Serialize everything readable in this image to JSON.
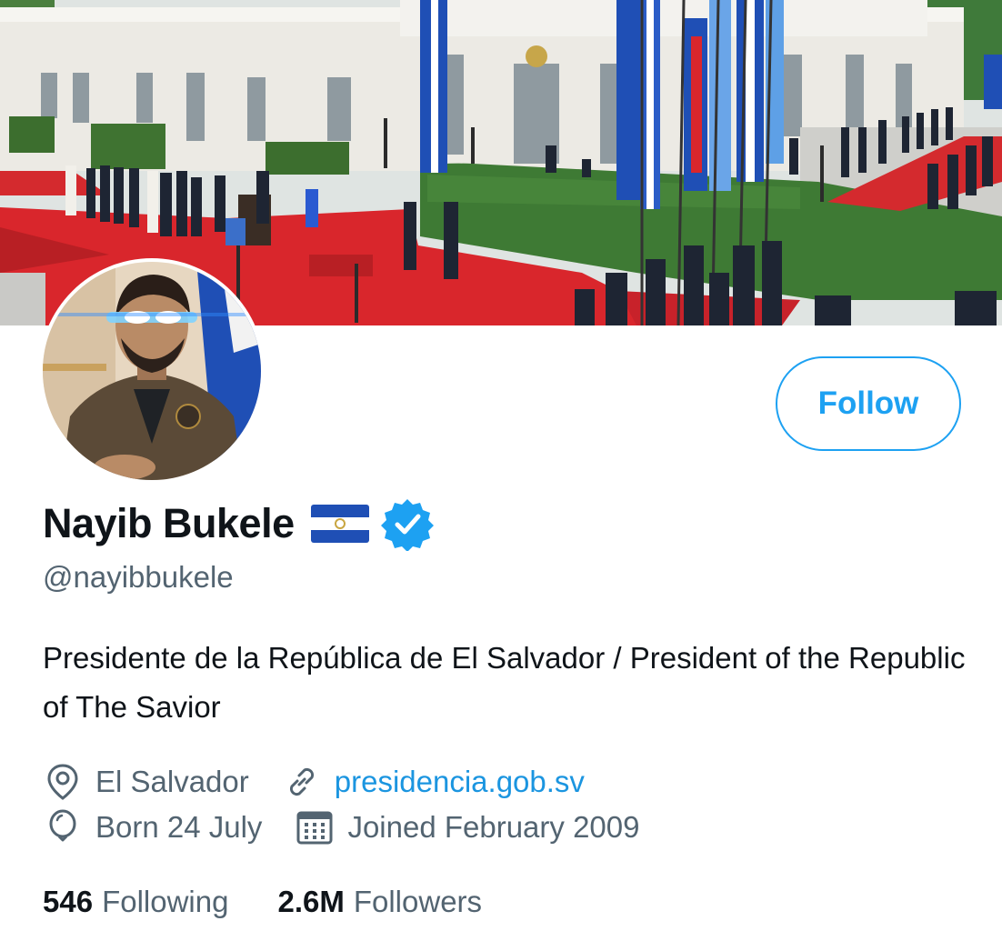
{
  "profile": {
    "display_name": "Nayib Bukele",
    "handle": "@nayibbukele",
    "bio": "Presidente de la República de El Salvador / President of the Republic of The Savior",
    "location": "El Salvador",
    "website": "presidencia.gob.sv",
    "birthday": "Born 24 July",
    "joined": "Joined February 2009",
    "verified": true,
    "flag_icon": "el-salvador-flag-icon"
  },
  "stats": {
    "following_count": "546",
    "following_label": "Following",
    "followers_count": "2.6M",
    "followers_label": "Followers"
  },
  "actions": {
    "follow_label": "Follow"
  },
  "icons": {
    "location": "location-pin-icon",
    "link": "link-icon",
    "birthday": "balloon-icon",
    "joined": "calendar-icon",
    "verified": "verified-badge-icon"
  },
  "colors": {
    "accent": "#1da1f2",
    "link": "#1b95e0",
    "secondary_text": "#536471",
    "primary_text": "#0f1419",
    "carpet": "#d9262c",
    "flag_blue": "#1f4fb5"
  }
}
